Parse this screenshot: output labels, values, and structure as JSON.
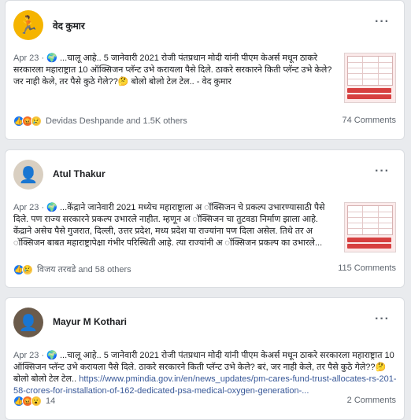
{
  "posts": [
    {
      "author": "वेद कुमार",
      "date": "Apr 23 ·",
      "text": "...चालू आहे.. 5 जानेवारी 2021 रोजी पंतप्रधान मोदी यांनी पीएम केअर्स मधून ठाकरे सरकारला महाराष्ट्रात 10 ऑक्सिजन प्लॅन्ट उभे करायला पैसे दिले. ठाकरे सरकारने किती प्लॅन्ट उभे केले? जर नाही केले, तर पैसे कुठे गेले??🤔 बोलो बोलो टेल टेल.. - वेद कुमार",
      "reacted_by": "Devidas Deshpande and 1.5K others",
      "comments": "74 Comments",
      "avatar_icon": "running-person-icon"
    },
    {
      "author": "Atul Thakur",
      "date": "Apr 23 ·",
      "text": "...केंद्राने जानेवारी 2021 मध्येच महाराष्ट्राला अ ॉक्सिजन चे प्रकल्प उभारण्यासाठी पैसे दिले. पण राज्य सरकारने प्रकल्प उभारले नाहीत. म्हणून अ ॉक्सिजन चा तुटवडा निर्माण झाला आहे. केंद्राने असेच पैसे गुजरात, दिल्ली, उत्तर प्रदेश, मध्य प्रदेश या राज्यांना पण दिला असेल. तिथे तर अ ॉक्सिजन बाबत महाराष्ट्रापेक्षा गंभीर परिस्थिती आहे. त्या राज्यांनी अ ॉक्सिजन प्रकल्प का उभारले...",
      "reacted_by": "विजय तरवडे and 58 others",
      "comments": "115 Comments",
      "avatar_icon": "person-photo-icon"
    },
    {
      "author": "Mayur M Kothari",
      "date": "Apr 23 ·",
      "text": "...चालू आहे.. 5 जानेवारी 2021 रोजी पंतप्रधान मोदी यांनी पीएम केअर्स मधून ठाकरे सरकारला महाराष्ट्रात 10 ऑक्सिजन प्लॅन्ट उभे करायला पैसे दिले. ठाकरे सरकारने किती प्लॅन्ट उभे केले? बरं, जर नाही केले, तर पैसे कुठे गेले??🤔 बोलो बोलो टेल टेल.. ",
      "link": "https://www.pmindia.gov.in/en/news_updates/pm-cares-fund-trust-allocates-rs-201-58-crores-for-installation-of-162-dedicated-psa-medical-oxygen-generation-...",
      "reacted_by": "14",
      "comments": "2 Comments",
      "avatar_icon": "person-photo-icon"
    }
  ],
  "more_label": "···",
  "globe_icon": "🌍"
}
